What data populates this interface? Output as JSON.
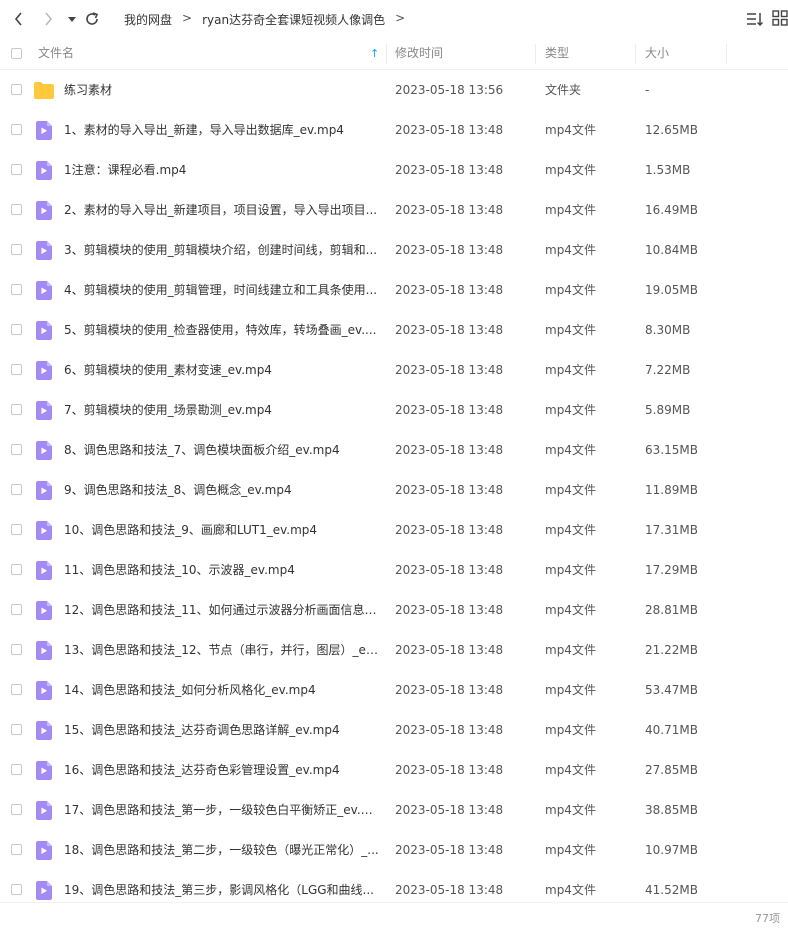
{
  "toolbar": {
    "breadcrumb": [
      "我的网盘",
      "ryan达芬奇全套课短视频人像调色"
    ],
    "separator": ">",
    "icons": [
      "chevron-left-icon",
      "chevron-right-icon",
      "caret-down-icon",
      "refresh-icon",
      "sort-list-icon",
      "grid-view-icon"
    ]
  },
  "header": {
    "name": "文件名",
    "time": "修改时间",
    "type": "类型",
    "size": "大小",
    "sort_indicator": "↑"
  },
  "colors": {
    "accent": "#06a7ff",
    "folder": "#ffc83d",
    "video": "#a48bf3"
  },
  "files": [
    {
      "name": "练习素材",
      "time": "2023-05-18 13:56",
      "type": "文件夹",
      "size": "-",
      "kind": "folder"
    },
    {
      "name": "1、素材的导入导出_新建，导入导出数据库_ev.mp4",
      "time": "2023-05-18 13:48",
      "type": "mp4文件",
      "size": "12.65MB",
      "kind": "video"
    },
    {
      "name": "1注意：课程必看.mp4",
      "time": "2023-05-18 13:48",
      "type": "mp4文件",
      "size": "1.53MB",
      "kind": "video"
    },
    {
      "name": "2、素材的导入导出_新建项目，项目设置，导入导出项目...",
      "time": "2023-05-18 13:48",
      "type": "mp4文件",
      "size": "16.49MB",
      "kind": "video"
    },
    {
      "name": "3、剪辑模块的使用_剪辑模块介绍，创建时间线，剪辑和...",
      "time": "2023-05-18 13:48",
      "type": "mp4文件",
      "size": "10.84MB",
      "kind": "video"
    },
    {
      "name": "4、剪辑模块的使用_剪辑管理，时间线建立和工具条使用...",
      "time": "2023-05-18 13:48",
      "type": "mp4文件",
      "size": "19.05MB",
      "kind": "video"
    },
    {
      "name": "5、剪辑模块的使用_检查器使用，特效库，转场叠画_ev....",
      "time": "2023-05-18 13:48",
      "type": "mp4文件",
      "size": "8.30MB",
      "kind": "video"
    },
    {
      "name": "6、剪辑模块的使用_素材变速_ev.mp4",
      "time": "2023-05-18 13:48",
      "type": "mp4文件",
      "size": "7.22MB",
      "kind": "video"
    },
    {
      "name": "7、剪辑模块的使用_场景勘测_ev.mp4",
      "time": "2023-05-18 13:48",
      "type": "mp4文件",
      "size": "5.89MB",
      "kind": "video"
    },
    {
      "name": "8、调色思路和技法_7、调色模块面板介绍_ev.mp4",
      "time": "2023-05-18 13:48",
      "type": "mp4文件",
      "size": "63.15MB",
      "kind": "video"
    },
    {
      "name": "9、调色思路和技法_8、调色概念_ev.mp4",
      "time": "2023-05-18 13:48",
      "type": "mp4文件",
      "size": "11.89MB",
      "kind": "video"
    },
    {
      "name": "10、调色思路和技法_9、画廊和LUT1_ev.mp4",
      "time": "2023-05-18 13:48",
      "type": "mp4文件",
      "size": "17.31MB",
      "kind": "video"
    },
    {
      "name": "11、调色思路和技法_10、示波器_ev.mp4",
      "time": "2023-05-18 13:48",
      "type": "mp4文件",
      "size": "17.29MB",
      "kind": "video"
    },
    {
      "name": "12、调色思路和技法_11、如何通过示波器分析画面信息_...",
      "time": "2023-05-18 13:48",
      "type": "mp4文件",
      "size": "28.81MB",
      "kind": "video"
    },
    {
      "name": "13、调色思路和技法_12、节点（串行，并行，图层）_ev...",
      "time": "2023-05-18 13:48",
      "type": "mp4文件",
      "size": "21.22MB",
      "kind": "video"
    },
    {
      "name": "14、调色思路和技法_如何分析风格化_ev.mp4",
      "time": "2023-05-18 13:48",
      "type": "mp4文件",
      "size": "53.47MB",
      "kind": "video"
    },
    {
      "name": "15、调色思路和技法_达芬奇调色思路详解_ev.mp4",
      "time": "2023-05-18 13:48",
      "type": "mp4文件",
      "size": "40.71MB",
      "kind": "video"
    },
    {
      "name": "16、调色思路和技法_达芬奇色彩管理设置_ev.mp4",
      "time": "2023-05-18 13:48",
      "type": "mp4文件",
      "size": "27.85MB",
      "kind": "video"
    },
    {
      "name": "17、调色思路和技法_第一步，一级较色白平衡矫正_ev.m...",
      "time": "2023-05-18 13:48",
      "type": "mp4文件",
      "size": "38.85MB",
      "kind": "video"
    },
    {
      "name": "18、调色思路和技法_第二步，一级较色（曝光正常化）_...",
      "time": "2023-05-18 13:48",
      "type": "mp4文件",
      "size": "10.97MB",
      "kind": "video"
    },
    {
      "name": "19、调色思路和技法_第三步，影调风格化（LGG和曲线...",
      "time": "2023-05-18 13:48",
      "type": "mp4文件",
      "size": "41.52MB",
      "kind": "video"
    }
  ],
  "footer": {
    "count": "77项"
  }
}
